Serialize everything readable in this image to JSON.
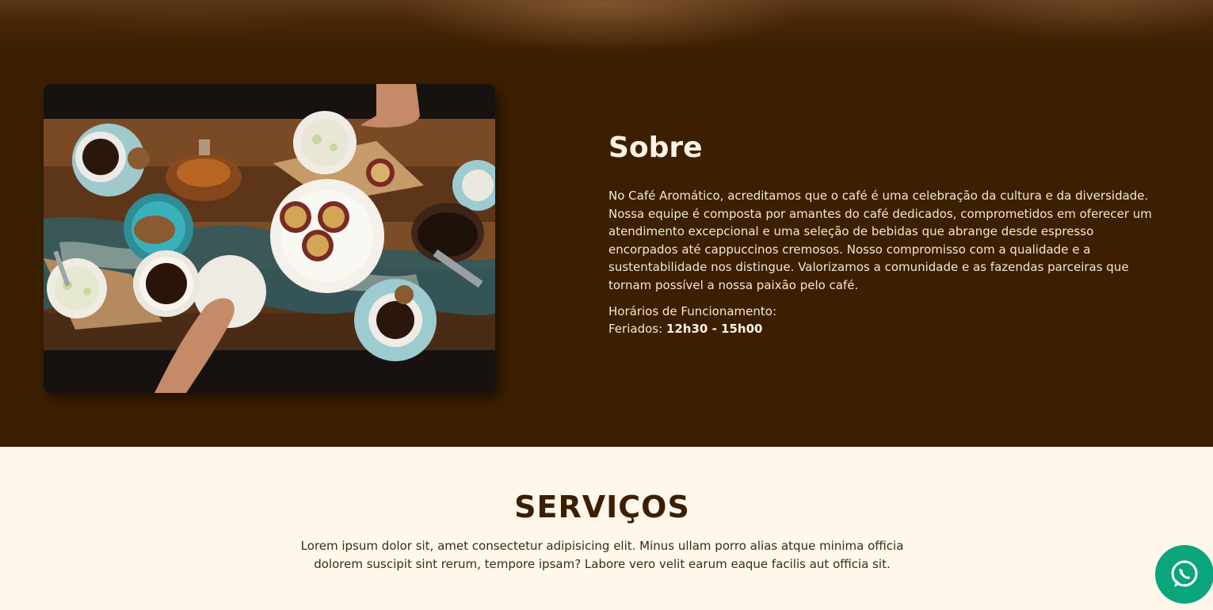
{
  "about": {
    "title": "Sobre",
    "body": "No Café Aromático, acreditamos que o café é uma celebração da cultura e da diversidade. Nossa equipe é composta por amantes do café dedicados, comprometidos em oferecer um atendimento excepcional e uma seleção de bebidas que abrange desde espresso encorpados até cappuccinos cremosos. Nosso compromisso com a qualidade e a sustentabilidade nos distingue. Valorizamos a comunidade e as fazendas parceiras que tornam possível a nossa paixão pelo café.",
    "hours_label": "Horários de Funcionamento:",
    "hours_day": "Feriados:",
    "hours_time": "12h30 - 15h00"
  },
  "services": {
    "title": "SERVIÇOS",
    "description": "Lorem ipsum dolor sit, amet consectetur adipisicing elit. Minus ullam porro alias atque minima officia dolorem suscipit sint rerum, tempore ipsam? Labore vero velit earum eaque facilis aut officia sit."
  },
  "icons": {
    "whatsapp": "whatsapp-icon"
  },
  "colors": {
    "about_bg": "#3b1f00",
    "services_bg": "#fff7ea",
    "title_brown": "#3b1f00",
    "whatsapp_green": "#0aa57c"
  }
}
